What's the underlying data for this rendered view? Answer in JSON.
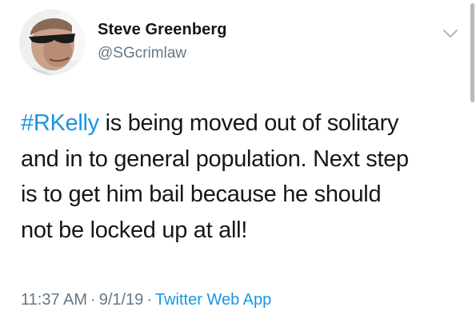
{
  "tweet": {
    "author": {
      "display_name": "Steve Greenberg",
      "handle": "@SGcrimlaw",
      "avatar_icon": "profile-photo-avatar"
    },
    "menu_icon": "chevron-down-icon",
    "text": {
      "hashtag": "#RKelly",
      "line1_rest": " is being moved out of solitary",
      "line2": "and in to general population. Next step",
      "line3": "is to get him bail because he should",
      "line4": "not be locked up at all!"
    },
    "meta": {
      "time": "11:37 AM",
      "separator": "·",
      "date": "9/1/19",
      "source": "Twitter Web App"
    }
  },
  "colors": {
    "link": "#1b95e0",
    "secondary_text": "#657786",
    "primary_text": "#14171a",
    "background": "#ffffff"
  }
}
